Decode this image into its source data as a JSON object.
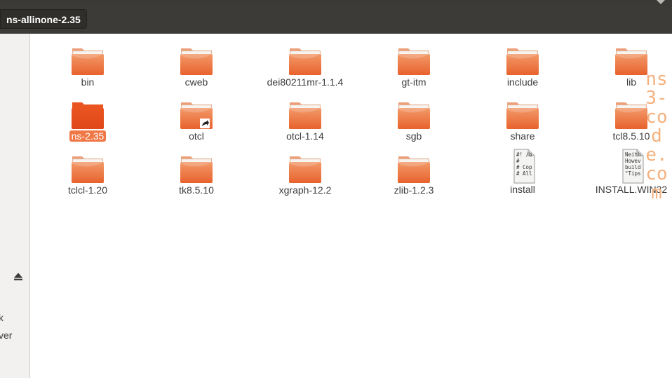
{
  "path": {
    "current": "ns-allinone-2.35"
  },
  "sidebar": {
    "fragments": [
      "k",
      "ver"
    ]
  },
  "items": [
    {
      "name": "bin",
      "type": "folder"
    },
    {
      "name": "cweb",
      "type": "folder"
    },
    {
      "name": "dei80211mr-1.1.4",
      "type": "folder"
    },
    {
      "name": "gt-itm",
      "type": "folder"
    },
    {
      "name": "include",
      "type": "folder"
    },
    {
      "name": "lib",
      "type": "folder"
    },
    {
      "name": "ns-2.35",
      "type": "folder",
      "selected": true
    },
    {
      "name": "otcl",
      "type": "folder-link"
    },
    {
      "name": "otcl-1.14",
      "type": "folder"
    },
    {
      "name": "sgb",
      "type": "folder"
    },
    {
      "name": "share",
      "type": "folder"
    },
    {
      "name": "tcl8.5.10",
      "type": "folder"
    },
    {
      "name": "tclcl-1.20",
      "type": "folder"
    },
    {
      "name": "tk8.5.10",
      "type": "folder"
    },
    {
      "name": "xgraph-12.2",
      "type": "folder"
    },
    {
      "name": "zlib-1.2.3",
      "type": "folder"
    },
    {
      "name": "install",
      "type": "script",
      "preview": [
        "#! /b",
        "#",
        "# Cop",
        "# All"
      ]
    },
    {
      "name": "INSTALL.WIN32",
      "type": "text",
      "preview": [
        "Neith",
        "Howev",
        "build",
        "\"Tips"
      ]
    }
  ],
  "watermark": "ns3-code.com",
  "colors": {
    "folder_body": "#f07746",
    "folder_selected": "#e95420",
    "selection": "#f07746",
    "watermark": "#f5b27f"
  }
}
